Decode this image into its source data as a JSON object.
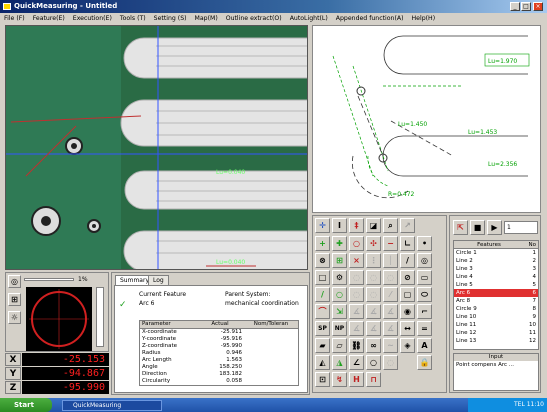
{
  "window": {
    "title": "QuickMeasuring - Untitled"
  },
  "menu": [
    "File (F)",
    "Feature(E)",
    "Execution(E)",
    "Tools (T)",
    "Setting (S)",
    "Map(M)",
    "Outline extract(O)",
    "AutoLight(L)",
    "Appended function(A)",
    "Help(H)"
  ],
  "cad": {
    "labels": [
      "Lu=1.970",
      "Lu=1.450",
      "Lu=1.453",
      "Lu=2.356",
      "R=0.472"
    ]
  },
  "camera": {
    "labels": [
      "Lu=0.040",
      "Lu=0.040"
    ]
  },
  "tabs": [
    "Summary",
    "Log"
  ],
  "summary": {
    "current_feature_label": "Current Feature",
    "current_feature_value": "Arc 6",
    "parent_system_label": "Parent System:",
    "parent_system_value": "mechanical coordination",
    "table_headers": [
      "Parameter",
      "Actual",
      "Nom/Toleran"
    ],
    "table_rows": [
      [
        "X-coordinate",
        "-25.911",
        ""
      ],
      [
        "Y-coordinate",
        "-95.916",
        ""
      ],
      [
        "Z-coordinate",
        "-95.990",
        ""
      ],
      [
        "Radius",
        "0.946",
        ""
      ],
      [
        "Arc Length",
        "1.563",
        ""
      ],
      [
        "Angle",
        "158.250",
        ""
      ],
      [
        "Direction",
        "183.182",
        ""
      ],
      [
        "Circularity",
        "0.058",
        ""
      ]
    ]
  },
  "gauge": {
    "scale_label": "1%"
  },
  "readouts": [
    {
      "axis": "X",
      "value": "-25.153"
    },
    {
      "axis": "Y",
      "value": "-94.867"
    },
    {
      "axis": "Z",
      "value": "-95.990"
    }
  ],
  "features": {
    "headers": [
      "Features",
      "No"
    ],
    "items": [
      {
        "name": "Circle 1",
        "idx": "1"
      },
      {
        "name": "Line 2",
        "idx": "2"
      },
      {
        "name": "Line 3",
        "idx": "3"
      },
      {
        "name": "Line 4",
        "idx": "4"
      },
      {
        "name": "Line 5",
        "idx": "5"
      },
      {
        "name": "Arc 6",
        "idx": "6",
        "selected": true
      },
      {
        "name": "Arc 8",
        "idx": "7"
      },
      {
        "name": "Circle 9",
        "idx": "8"
      },
      {
        "name": "Line 10",
        "idx": "9"
      },
      {
        "name": "Line 11",
        "idx": "10"
      },
      {
        "name": "Line 12",
        "idx": "11"
      },
      {
        "name": "Line 13",
        "idx": "12"
      }
    ],
    "input_label": "Input",
    "input_text": "Point compens    Arc ..."
  },
  "toolbar_spin_value": "1",
  "taskbar": {
    "start": "Start",
    "app": "QuickMeasuring",
    "tray_text": "TEL 11:10"
  },
  "colors": {
    "readout_text": "#ff2020",
    "camera_bg": "#1f5e3c",
    "selected_row": "#e03030"
  }
}
